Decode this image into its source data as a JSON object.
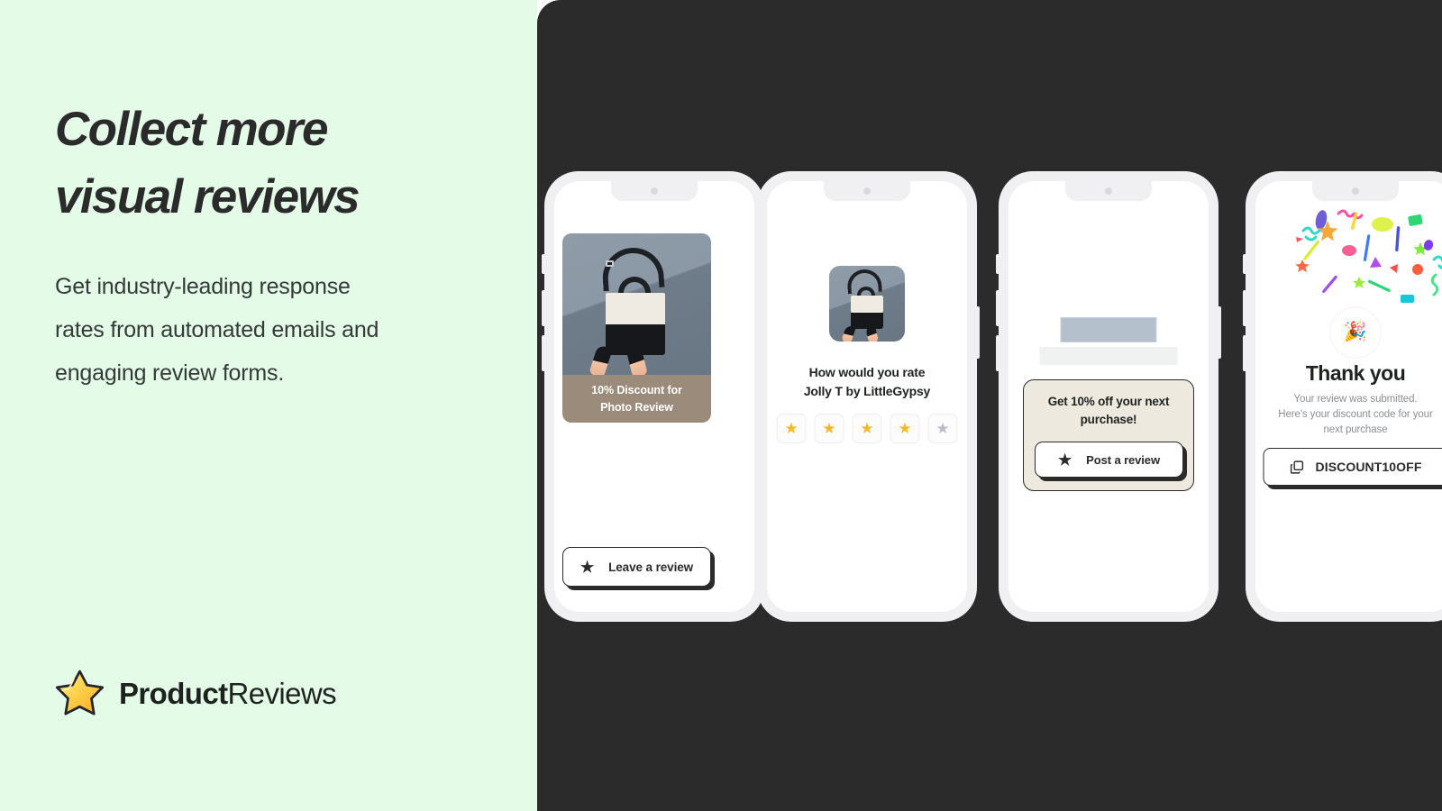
{
  "theme": {
    "mint_background": "#E4FBE8",
    "dark_panel": "#2B2B2B",
    "star_gold": "#F5B827",
    "star_gray": "#B8BEC8",
    "caption_tan": "#9A8B7A",
    "offer_beige": "#EDE9DF",
    "skeleton_blue": "#B4C1CC",
    "skeleton_gray": "#F0F1F1"
  },
  "left": {
    "headline": {
      "line1": "Collect more",
      "line2": "visual reviews"
    },
    "subcopy": {
      "line1": "Get industry-leading response",
      "line2": "rates from automated emails and",
      "line3": "engaging review forms."
    },
    "logo": {
      "icon": "star-icon",
      "name_bold": "Product",
      "name_regular": "Reviews"
    }
  },
  "phones": {
    "phone1": {
      "card": {
        "image_alt": "tote-bag-product-photo",
        "caption_line1": "10% Discount for",
        "caption_line2": "Photo Review"
      },
      "cta": {
        "icon": "star-icon",
        "label": "Leave a review"
      }
    },
    "phone2": {
      "thumbnail_alt": "tote-bag-product-thumbnail",
      "question_line1": "How would you rate",
      "question_line2": "Jolly T by LittleGypsy",
      "rating": {
        "value": 4,
        "max": 5,
        "filled_glyph": "★",
        "empty_glyph": "★"
      }
    },
    "phone3": {
      "offer": {
        "title_line1": "Get 10% off your next",
        "title_line2": "purchase!",
        "cta": {
          "icon": "star-icon",
          "label": "Post a review"
        }
      }
    },
    "phone4": {
      "celebration_emoji": "🎉",
      "title": "Thank you",
      "subtitle_line1": "Your review was submitted.",
      "subtitle_line2": "Here's your discount code for your",
      "subtitle_line3": "next purchase",
      "discount_button": {
        "icon": "copy-icon",
        "code": "DISCOUNT10OFF"
      }
    }
  }
}
